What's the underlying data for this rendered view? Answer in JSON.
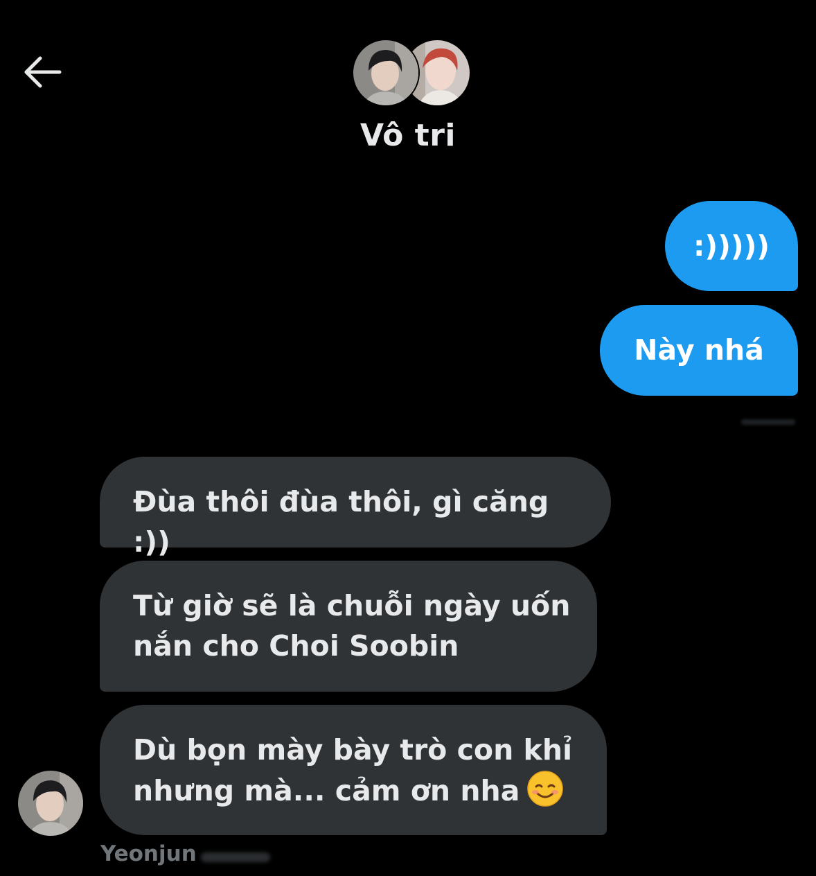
{
  "header": {
    "back_icon": "arrow-left-icon",
    "title": "Vô tri",
    "avatars": [
      "avatar-dark-hair",
      "avatar-red-hair"
    ]
  },
  "messages": [
    {
      "direction": "sent",
      "text": ":)))))"
    },
    {
      "direction": "sent",
      "text": "Này nhá"
    },
    {
      "direction": "received",
      "text": "Đùa thôi đùa thôi, gì căng :))"
    },
    {
      "direction": "received",
      "lines": [
        "Từ giờ sẽ là chuỗi ngày uốn",
        "nắn cho Choi Soobin"
      ]
    },
    {
      "direction": "received",
      "lines": [
        "Dù bọn mày bày trò con khỉ",
        "nhưng mà... cảm ơn nha"
      ],
      "emoji": "smiling-face-icon"
    }
  ],
  "sender": {
    "name": "Yeonjun"
  },
  "colors": {
    "background": "#000000",
    "sent_bubble": "#1d9bf0",
    "received_bubble": "#2f3336",
    "text_primary": "#e7e9ea",
    "text_secondary": "#71767b"
  }
}
